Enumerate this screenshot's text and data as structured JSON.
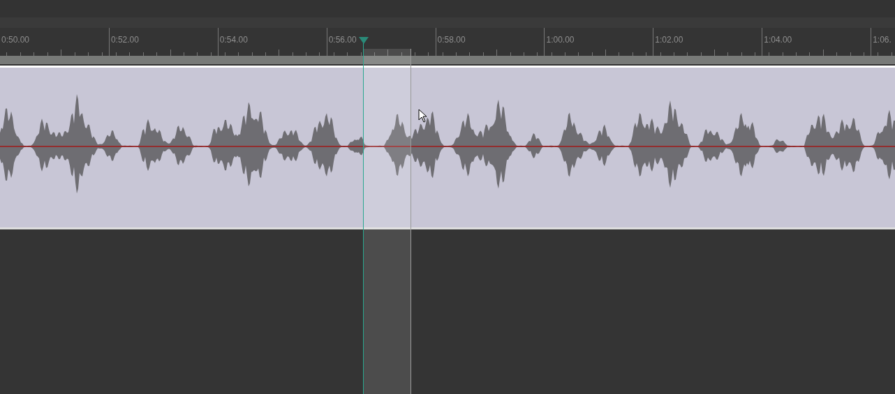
{
  "ruler": {
    "labels": [
      "0:50.00",
      "0:52.00",
      "0:54.00",
      "0:56.00",
      "0:58.00",
      "1:00.00",
      "1:02.00",
      "1:04.00",
      "1:06."
    ]
  }
}
